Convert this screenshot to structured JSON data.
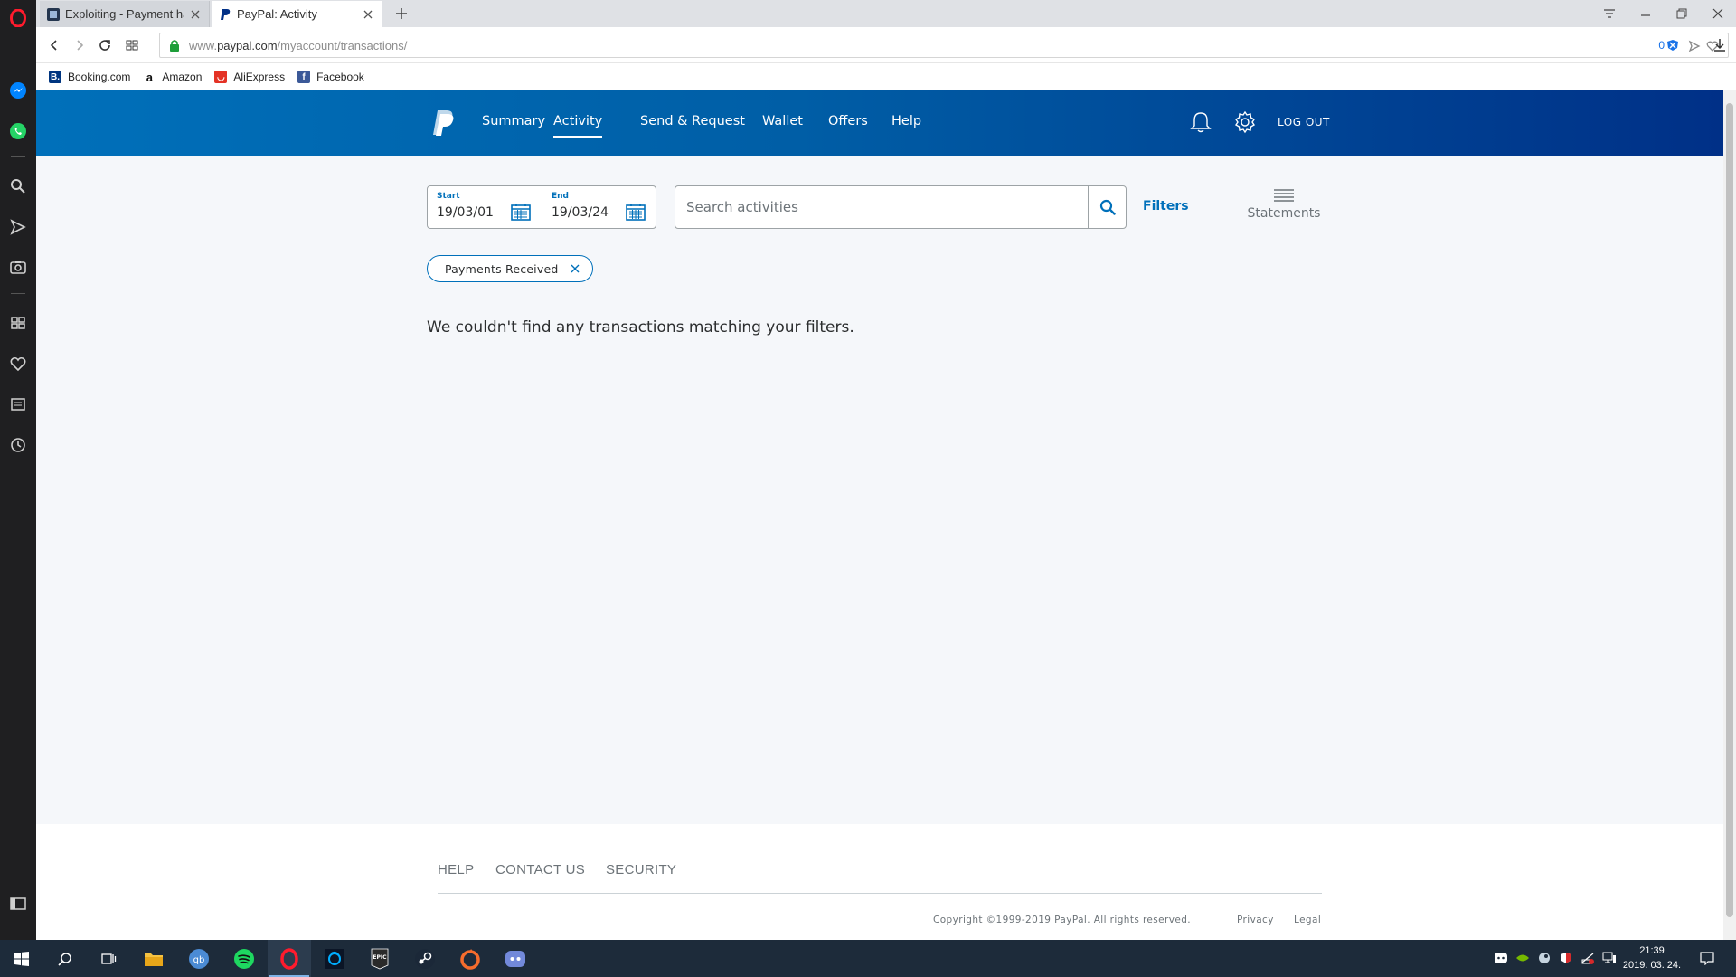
{
  "browser": {
    "tabs": [
      {
        "title": "Exploiting - Payment has",
        "favicon": "bookmark-site-icon",
        "active": false
      },
      {
        "title": "PayPal: Activity",
        "favicon": "paypal-icon",
        "active": true
      }
    ],
    "url_prefix": "www.",
    "url_domain": "paypal.com",
    "url_path": "/myaccount/transactions/",
    "adblock_count": "0",
    "bookmarks": [
      {
        "label": "Booking.com",
        "icon": "booking-icon",
        "color": "#003580",
        "glyph": "B."
      },
      {
        "label": "Amazon",
        "icon": "amazon-icon",
        "color": "#ffffff",
        "glyph": "a"
      },
      {
        "label": "AliExpress",
        "icon": "aliexpress-icon",
        "color": "#e43225",
        "glyph": "A"
      },
      {
        "label": "Facebook",
        "icon": "facebook-icon",
        "color": "#3b5998",
        "glyph": "f"
      }
    ]
  },
  "paypal": {
    "nav": {
      "summary": "Summary",
      "activity": "Activity",
      "send_request": "Send & Request",
      "wallet": "Wallet",
      "offers": "Offers",
      "help": "Help",
      "logout": "LOG OUT"
    },
    "filters": {
      "start_label": "Start",
      "start_value": "19/03/01",
      "end_label": "End",
      "end_value": "19/03/24",
      "search_placeholder": "Search activities",
      "filters_link": "Filters",
      "statements_label": "Statements",
      "active_chip": "Payments Received"
    },
    "empty_message": "We couldn't find any transactions matching your filters.",
    "footer": {
      "help": "HELP",
      "contact": "CONTACT US",
      "security": "SECURITY",
      "copyright": "Copyright ©1999-2019 PayPal. All rights reserved.",
      "privacy": "Privacy",
      "legal": "Legal"
    },
    "colors": {
      "header_start": "#0070ba",
      "header_end": "#003087",
      "link_blue": "#0070ba",
      "page_bg": "#f5f7fa"
    }
  },
  "taskbar": {
    "clock_time": "21:39",
    "clock_date": "2019. 03. 24.",
    "apps": [
      "start-icon",
      "search-icon",
      "task-view-icon",
      "file-explorer-icon",
      "qbittorrent-icon",
      "spotify-icon",
      "opera-icon",
      "battlenet-icon",
      "epic-games-icon",
      "steam-icon",
      "origin-icon",
      "discord-icon"
    ]
  }
}
